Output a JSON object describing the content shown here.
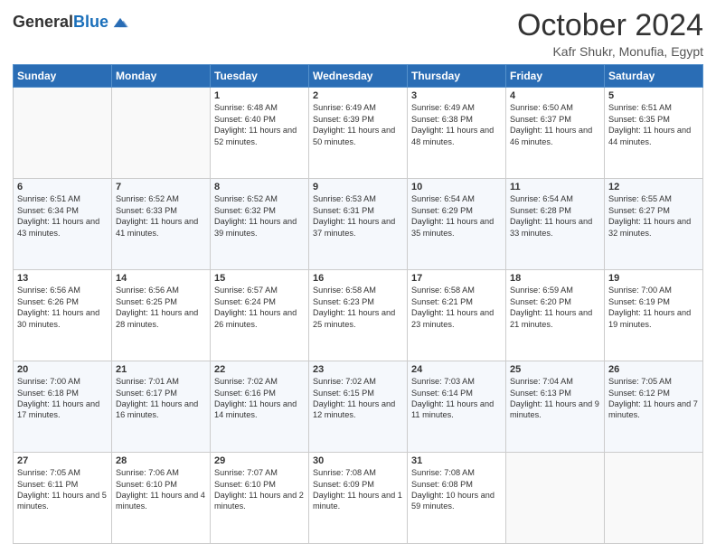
{
  "header": {
    "logo_general": "General",
    "logo_blue": "Blue",
    "month": "October 2024",
    "location": "Kafr Shukr, Monufia, Egypt"
  },
  "days_of_week": [
    "Sunday",
    "Monday",
    "Tuesday",
    "Wednesday",
    "Thursday",
    "Friday",
    "Saturday"
  ],
  "weeks": [
    [
      {
        "day": "",
        "text": ""
      },
      {
        "day": "",
        "text": ""
      },
      {
        "day": "1",
        "text": "Sunrise: 6:48 AM\nSunset: 6:40 PM\nDaylight: 11 hours and 52 minutes."
      },
      {
        "day": "2",
        "text": "Sunrise: 6:49 AM\nSunset: 6:39 PM\nDaylight: 11 hours and 50 minutes."
      },
      {
        "day": "3",
        "text": "Sunrise: 6:49 AM\nSunset: 6:38 PM\nDaylight: 11 hours and 48 minutes."
      },
      {
        "day": "4",
        "text": "Sunrise: 6:50 AM\nSunset: 6:37 PM\nDaylight: 11 hours and 46 minutes."
      },
      {
        "day": "5",
        "text": "Sunrise: 6:51 AM\nSunset: 6:35 PM\nDaylight: 11 hours and 44 minutes."
      }
    ],
    [
      {
        "day": "6",
        "text": "Sunrise: 6:51 AM\nSunset: 6:34 PM\nDaylight: 11 hours and 43 minutes."
      },
      {
        "day": "7",
        "text": "Sunrise: 6:52 AM\nSunset: 6:33 PM\nDaylight: 11 hours and 41 minutes."
      },
      {
        "day": "8",
        "text": "Sunrise: 6:52 AM\nSunset: 6:32 PM\nDaylight: 11 hours and 39 minutes."
      },
      {
        "day": "9",
        "text": "Sunrise: 6:53 AM\nSunset: 6:31 PM\nDaylight: 11 hours and 37 minutes."
      },
      {
        "day": "10",
        "text": "Sunrise: 6:54 AM\nSunset: 6:29 PM\nDaylight: 11 hours and 35 minutes."
      },
      {
        "day": "11",
        "text": "Sunrise: 6:54 AM\nSunset: 6:28 PM\nDaylight: 11 hours and 33 minutes."
      },
      {
        "day": "12",
        "text": "Sunrise: 6:55 AM\nSunset: 6:27 PM\nDaylight: 11 hours and 32 minutes."
      }
    ],
    [
      {
        "day": "13",
        "text": "Sunrise: 6:56 AM\nSunset: 6:26 PM\nDaylight: 11 hours and 30 minutes."
      },
      {
        "day": "14",
        "text": "Sunrise: 6:56 AM\nSunset: 6:25 PM\nDaylight: 11 hours and 28 minutes."
      },
      {
        "day": "15",
        "text": "Sunrise: 6:57 AM\nSunset: 6:24 PM\nDaylight: 11 hours and 26 minutes."
      },
      {
        "day": "16",
        "text": "Sunrise: 6:58 AM\nSunset: 6:23 PM\nDaylight: 11 hours and 25 minutes."
      },
      {
        "day": "17",
        "text": "Sunrise: 6:58 AM\nSunset: 6:21 PM\nDaylight: 11 hours and 23 minutes."
      },
      {
        "day": "18",
        "text": "Sunrise: 6:59 AM\nSunset: 6:20 PM\nDaylight: 11 hours and 21 minutes."
      },
      {
        "day": "19",
        "text": "Sunrise: 7:00 AM\nSunset: 6:19 PM\nDaylight: 11 hours and 19 minutes."
      }
    ],
    [
      {
        "day": "20",
        "text": "Sunrise: 7:00 AM\nSunset: 6:18 PM\nDaylight: 11 hours and 17 minutes."
      },
      {
        "day": "21",
        "text": "Sunrise: 7:01 AM\nSunset: 6:17 PM\nDaylight: 11 hours and 16 minutes."
      },
      {
        "day": "22",
        "text": "Sunrise: 7:02 AM\nSunset: 6:16 PM\nDaylight: 11 hours and 14 minutes."
      },
      {
        "day": "23",
        "text": "Sunrise: 7:02 AM\nSunset: 6:15 PM\nDaylight: 11 hours and 12 minutes."
      },
      {
        "day": "24",
        "text": "Sunrise: 7:03 AM\nSunset: 6:14 PM\nDaylight: 11 hours and 11 minutes."
      },
      {
        "day": "25",
        "text": "Sunrise: 7:04 AM\nSunset: 6:13 PM\nDaylight: 11 hours and 9 minutes."
      },
      {
        "day": "26",
        "text": "Sunrise: 7:05 AM\nSunset: 6:12 PM\nDaylight: 11 hours and 7 minutes."
      }
    ],
    [
      {
        "day": "27",
        "text": "Sunrise: 7:05 AM\nSunset: 6:11 PM\nDaylight: 11 hours and 5 minutes."
      },
      {
        "day": "28",
        "text": "Sunrise: 7:06 AM\nSunset: 6:10 PM\nDaylight: 11 hours and 4 minutes."
      },
      {
        "day": "29",
        "text": "Sunrise: 7:07 AM\nSunset: 6:10 PM\nDaylight: 11 hours and 2 minutes."
      },
      {
        "day": "30",
        "text": "Sunrise: 7:08 AM\nSunset: 6:09 PM\nDaylight: 11 hours and 1 minute."
      },
      {
        "day": "31",
        "text": "Sunrise: 7:08 AM\nSunset: 6:08 PM\nDaylight: 10 hours and 59 minutes."
      },
      {
        "day": "",
        "text": ""
      },
      {
        "day": "",
        "text": ""
      }
    ]
  ]
}
